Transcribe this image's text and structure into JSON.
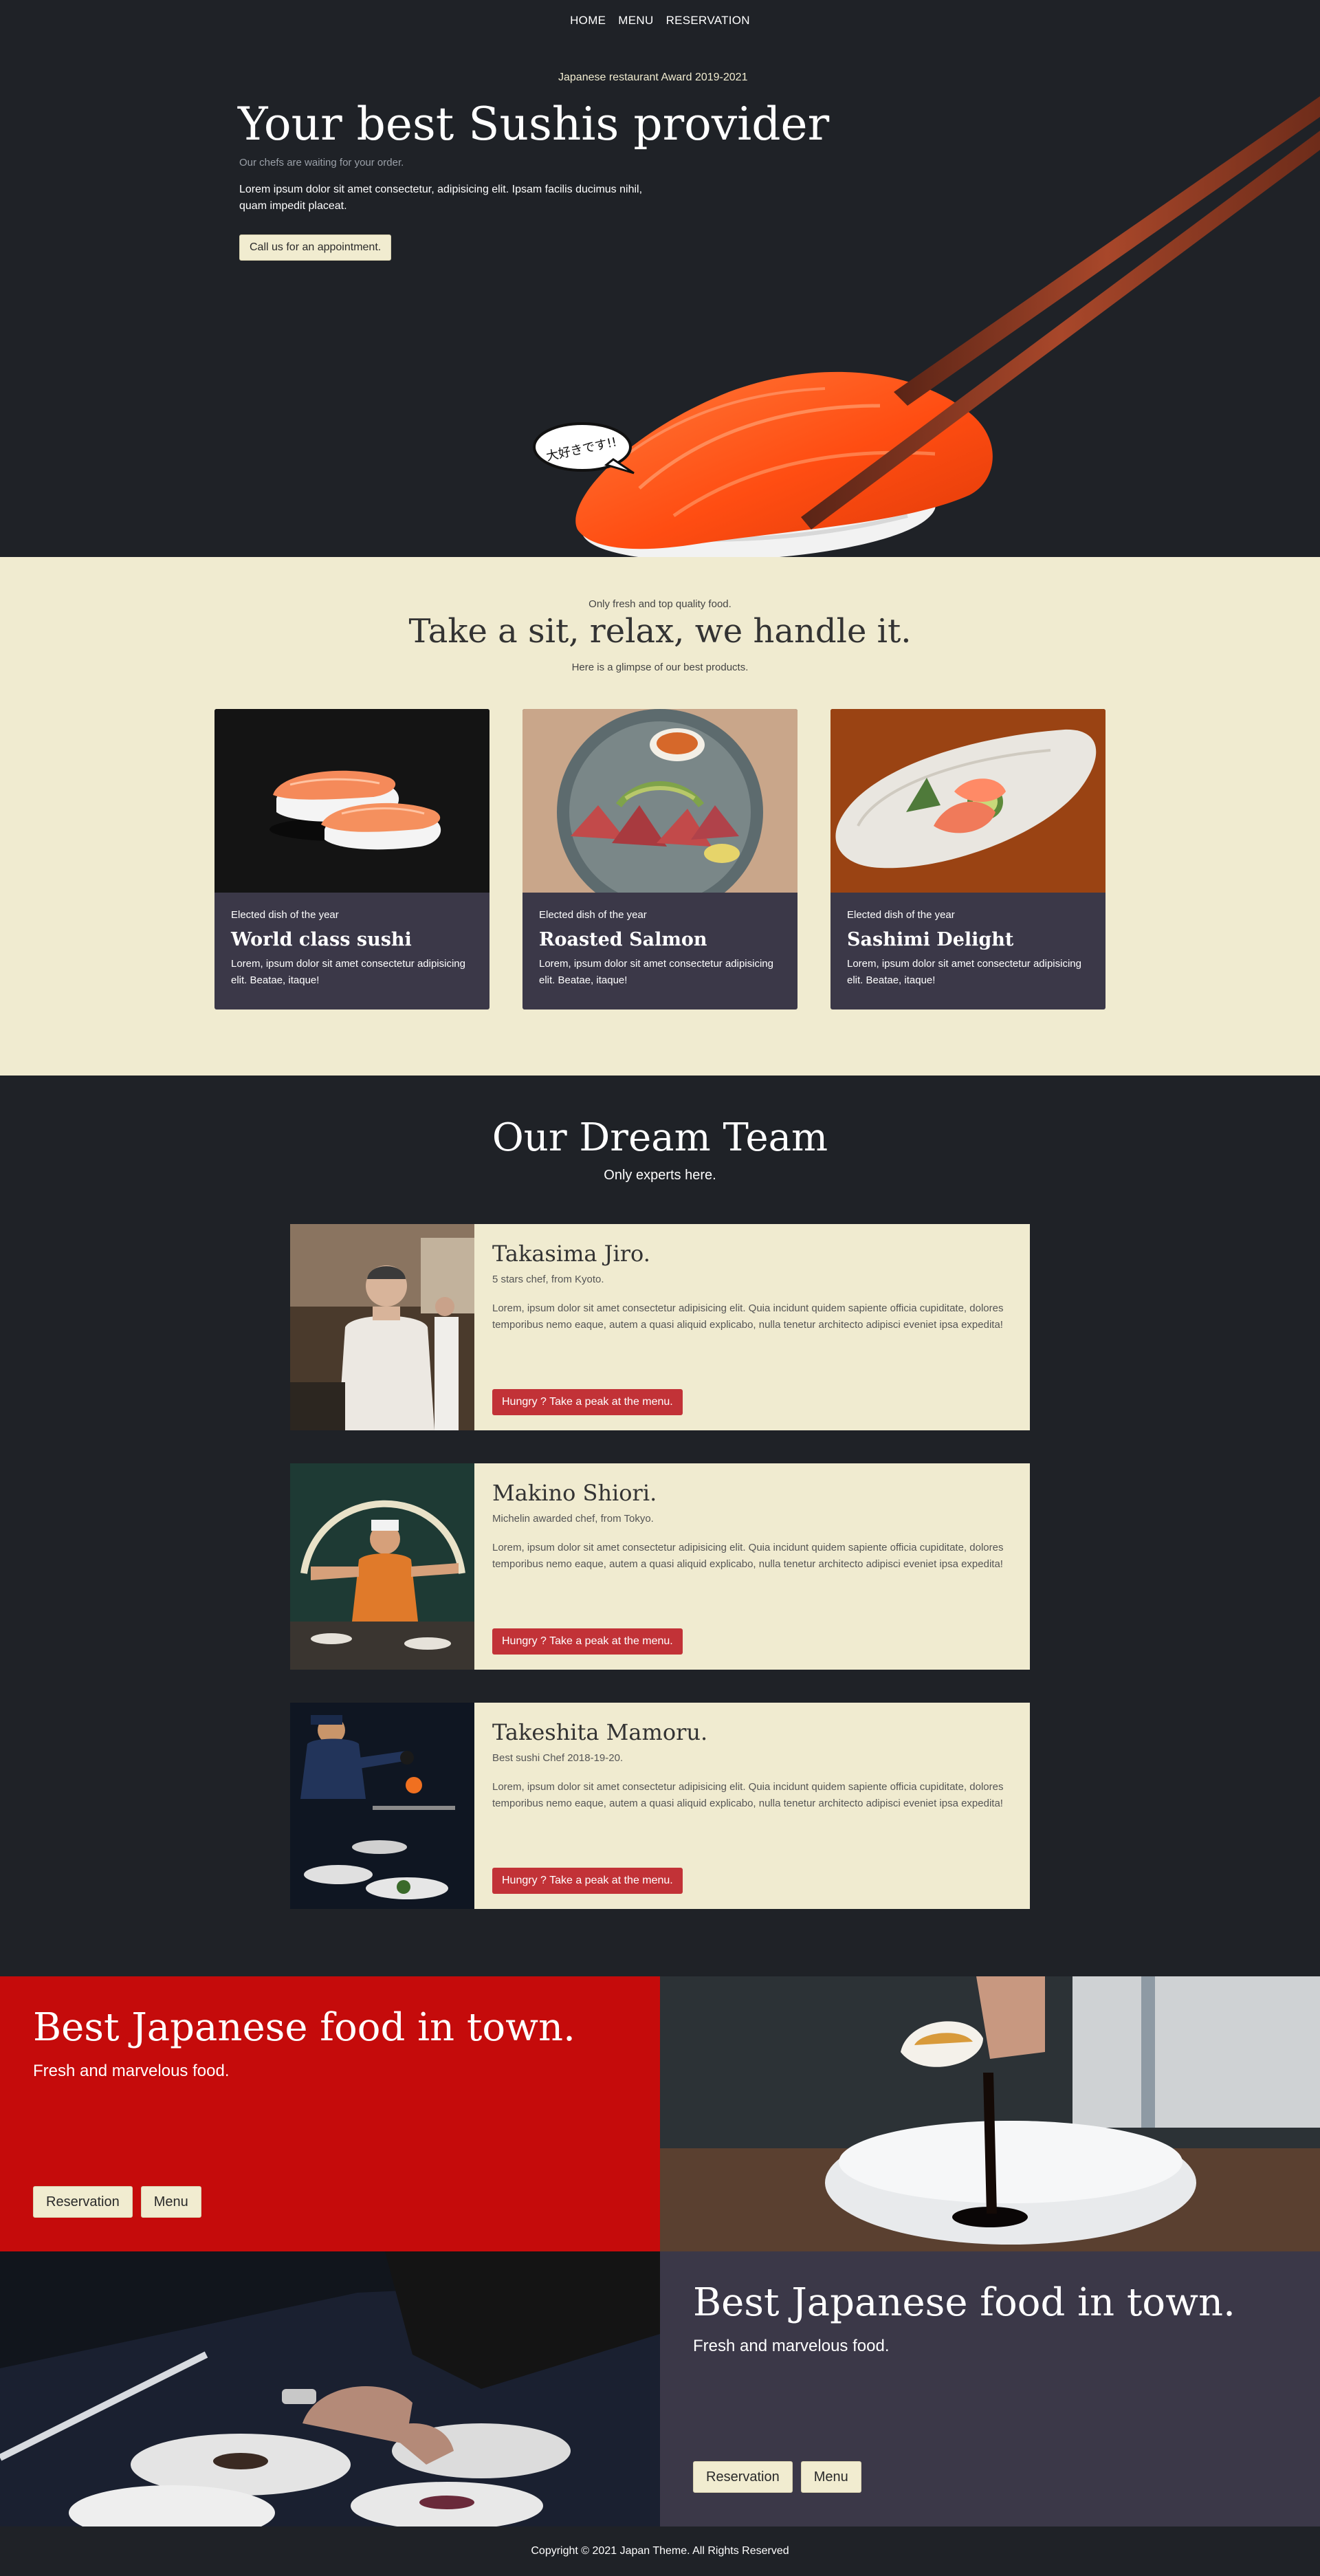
{
  "nav": {
    "items": [
      {
        "label": "HOME"
      },
      {
        "label": "MENU"
      },
      {
        "label": "RESERVATION"
      }
    ]
  },
  "hero": {
    "award": "Japanese restaurant Award 2019-2021",
    "title": "Your best Sushis provider",
    "subtitle": "Our chefs are waiting for your order.",
    "text": "Lorem ipsum dolor sit amet consectetur, adipisicing elit. Ipsam facilis ducimus nihil, quam impedit placeat.",
    "button_label": "Call us for an appointment.",
    "bubble_text": "大好きです!!"
  },
  "products": {
    "kicker": "Only fresh and top quality food.",
    "title": "Take a sit, relax, we handle it.",
    "subtitle": "Here is a glimpse of our best products.",
    "cards": [
      {
        "kicker": "Elected dish of the year",
        "title": "World class sushi",
        "text": "Lorem, ipsum dolor sit amet consectetur adipisicing elit. Beatae, itaque!"
      },
      {
        "kicker": "Elected dish of the year",
        "title": "Roasted Salmon",
        "text": "Lorem, ipsum dolor sit amet consectetur adipisicing elit. Beatae, itaque!"
      },
      {
        "kicker": "Elected dish of the year",
        "title": "Sashimi Delight",
        "text": "Lorem, ipsum dolor sit amet consectetur adipisicing elit. Beatae, itaque!"
      }
    ]
  },
  "team": {
    "title": "Our Dream Team",
    "subtitle": "Only experts here.",
    "members": [
      {
        "name": "Takasima Jiro.",
        "role": "5 stars chef, from Kyoto.",
        "text": "Lorem, ipsum dolor sit amet consectetur adipisicing elit. Quia incidunt quidem sapiente officia cupiditate, dolores temporibus nemo eaque, autem a quasi aliquid explicabo, nulla tenetur architecto adipisci eveniet ipsa expedita!",
        "button_label": "Hungry ? Take a peak at the menu."
      },
      {
        "name": "Makino Shiori.",
        "role": "Michelin awarded chef, from Tokyo.",
        "text": "Lorem, ipsum dolor sit amet consectetur adipisicing elit. Quia incidunt quidem sapiente officia cupiditate, dolores temporibus nemo eaque, autem a quasi aliquid explicabo, nulla tenetur architecto adipisci eveniet ipsa expedita!",
        "button_label": "Hungry ? Take a peak at the menu."
      },
      {
        "name": "Takeshita Mamoru.",
        "role": "Best sushi Chef 2018-19-20.",
        "text": "Lorem, ipsum dolor sit amet consectetur adipisicing elit. Quia incidunt quidem sapiente officia cupiditate, dolores temporibus nemo eaque, autem a quasi aliquid explicabo, nulla tenetur architecto adipisci eveniet ipsa expedita!",
        "button_label": "Hungry ? Take a peak at the menu."
      }
    ]
  },
  "promo": [
    {
      "title": "Best Japanese food in town.",
      "subtitle": "Fresh and marvelous food.",
      "reservation_label": "Reservation",
      "menu_label": "Menu"
    },
    {
      "title": "Best Japanese food in town.",
      "subtitle": "Fresh and marvelous food.",
      "reservation_label": "Reservation",
      "menu_label": "Menu"
    }
  ],
  "footer": {
    "text": "Copyright © 2021 Japan Theme. All Rights Reserved"
  },
  "colors": {
    "dark_bg": "#1f2227",
    "cream": "#f0ebd0",
    "card_dark": "#3b3848",
    "accent_red": "#c50b0b",
    "button_red": "#c23237",
    "salmon": "#ff5a1f"
  }
}
